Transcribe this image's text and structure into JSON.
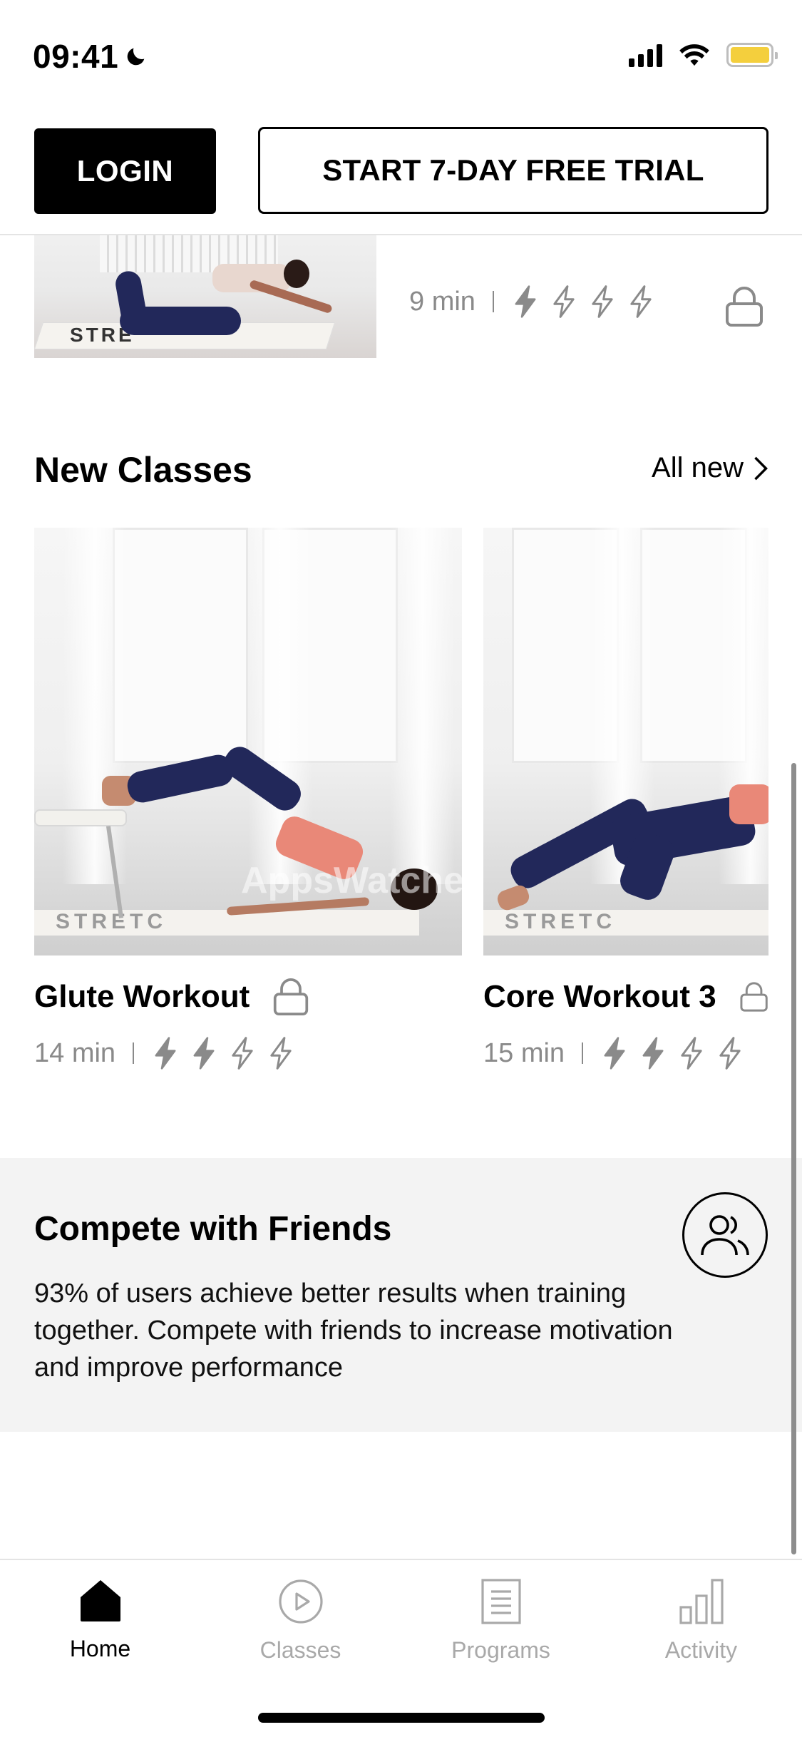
{
  "status_bar": {
    "time": "09:41",
    "moon_icon": "moon-icon",
    "signal_icon": "cellular-signal-icon",
    "wifi_icon": "wifi-icon",
    "battery_icon": "battery-icon",
    "battery_color": "#f4cf3d"
  },
  "header": {
    "login_label": "LOGIN",
    "trial_label": "START 7-DAY FREE TRIAL"
  },
  "previous_card": {
    "duration": "9 min",
    "intensity_filled": 1,
    "intensity_total": 4,
    "locked": true,
    "mat_text": "STRE"
  },
  "new_classes": {
    "title": "New Classes",
    "all_link": "All new",
    "items": [
      {
        "title": "Glute Workout",
        "duration": "14 min",
        "intensity_filled": 2,
        "intensity_total": 4,
        "locked": true,
        "mat_text": "STRETC"
      },
      {
        "title": "Core Workout 3",
        "duration": "15 min",
        "intensity_filled": 2,
        "intensity_total": 4,
        "locked": true,
        "mat_text": "STRETC"
      }
    ]
  },
  "watermark": "AppsWatcher.com",
  "compete": {
    "title": "Compete with Friends",
    "text": "93% of users achieve better results when training together. Compete with friends to increase motivation and improve performance",
    "icon": "friends-icon"
  },
  "tabbar": {
    "tabs": [
      {
        "label": "Home",
        "icon": "home-icon",
        "active": true
      },
      {
        "label": "Classes",
        "icon": "play-circle-icon",
        "active": false
      },
      {
        "label": "Programs",
        "icon": "document-list-icon",
        "active": false
      },
      {
        "label": "Activity",
        "icon": "bar-chart-icon",
        "active": false
      }
    ]
  },
  "colors": {
    "primary": "#000000",
    "muted_text": "#8a8a8a",
    "inactive_tab": "#a9a9a9",
    "card_bg": "#f3f3f3",
    "legging": "#22285a",
    "top": "#e98878"
  }
}
